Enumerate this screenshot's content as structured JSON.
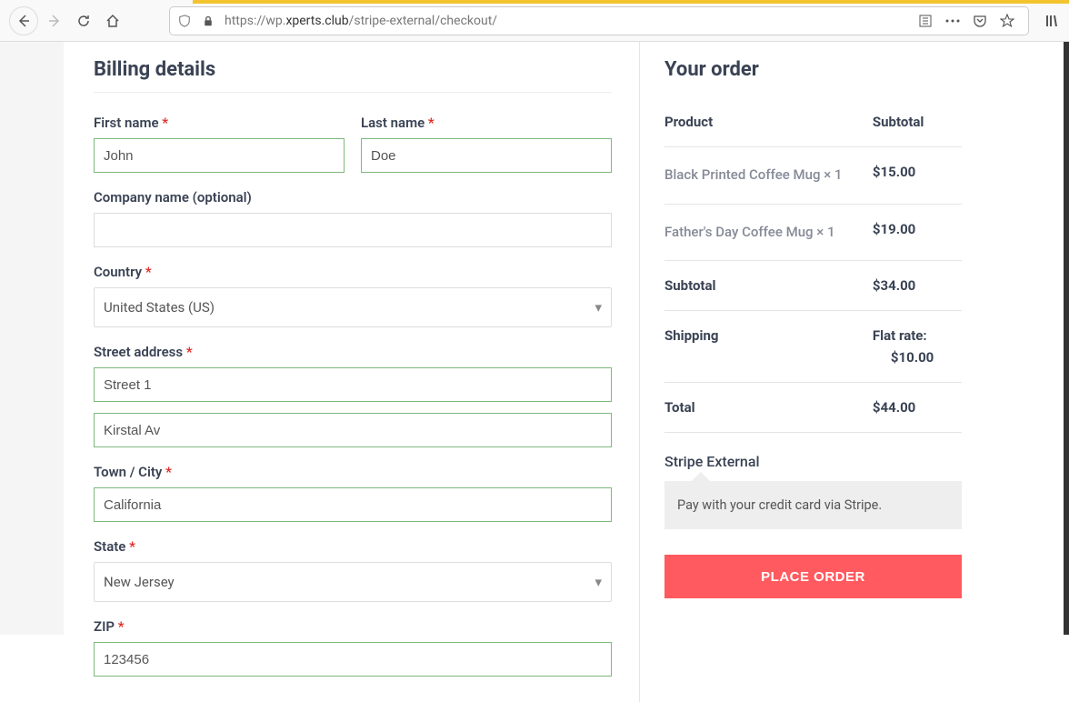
{
  "browser": {
    "url_prefix": "https://wp.",
    "url_domain": "xperts.club",
    "url_path": "/stripe-external/checkout/"
  },
  "billing": {
    "title": "Billing details",
    "first_name_label": "First name",
    "first_name": "John",
    "last_name_label": "Last name",
    "last_name": "Doe",
    "company_label": "Company name (optional)",
    "company": "",
    "country_label": "Country",
    "country": "United States (US)",
    "street_label": "Street address",
    "street1": "Street 1",
    "street2": "Kirstal Av",
    "city_label": "Town / City",
    "city": "California",
    "state_label": "State",
    "state": "New Jersey",
    "zip_label": "ZIP",
    "zip": "123456"
  },
  "order": {
    "title": "Your order",
    "product_header": "Product",
    "subtotal_header": "Subtotal",
    "items": [
      {
        "name": "Black Printed Coffee Mug   × 1",
        "price": "$15.00"
      },
      {
        "name": "Father's Day Coffee Mug   × 1",
        "price": "$19.00"
      }
    ],
    "subtotal_label": "Subtotal",
    "subtotal": "$34.00",
    "shipping_label": "Shipping",
    "shipping_method": "Flat rate:",
    "shipping_price": "$10.00",
    "total_label": "Total",
    "total": "$44.00",
    "payment_method_label": "Stripe External",
    "payment_desc": "Pay with your credit card via Stripe.",
    "place_order": "PLACE ORDER"
  }
}
